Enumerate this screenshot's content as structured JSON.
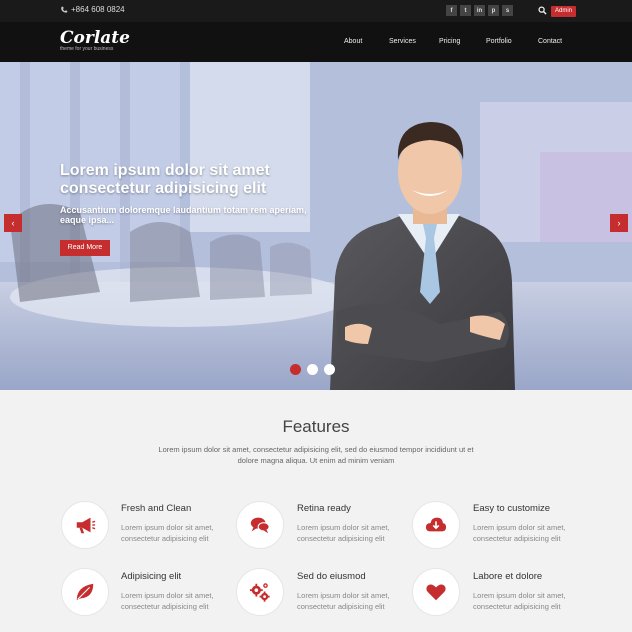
{
  "topbar": {
    "phone": "+864 608 0824",
    "social": [
      {
        "icon": "facebook-icon",
        "glyph": "f"
      },
      {
        "icon": "twitter-icon",
        "glyph": "t"
      },
      {
        "icon": "linkedin-icon",
        "glyph": "in"
      },
      {
        "icon": "pinterest-icon",
        "glyph": "p"
      },
      {
        "icon": "skype-icon",
        "glyph": "s"
      }
    ],
    "admin_label": "Admin"
  },
  "navbar": {
    "logo": "Corlate",
    "tagline": "theme for your business",
    "items": [
      "About",
      "Services",
      "Pricing",
      "Portfolio",
      "Contact"
    ]
  },
  "hero": {
    "title": "Lorem ipsum dolor sit amet consectetur adipisicing elit",
    "subtitle": "Accusantium doloremque laudantium totam rem aperiam, eaque ipsa...",
    "button": "Read More",
    "prev": "‹",
    "next": "›"
  },
  "features": {
    "title": "Features",
    "description": "Lorem ipsum dolor sit amet, consectetur adipisicing elit, sed do eiusmod tempor incididunt ut et dolore magna aliqua. Ut enim ad minim veniam",
    "items": [
      {
        "title": "Fresh and Clean",
        "text": "Lorem ipsum dolor sit amet, consectetur adipisicing elit",
        "icon": "megaphone-icon"
      },
      {
        "title": "Retina ready",
        "text": "Lorem ipsum dolor sit amet, consectetur adipisicing elit",
        "icon": "chat-icon"
      },
      {
        "title": "Easy to customize",
        "text": "Lorem ipsum dolor sit amet, consectetur adipisicing elit",
        "icon": "cloud-download-icon"
      },
      {
        "title": "Adipisicing elit",
        "text": "Lorem ipsum dolor sit amet, consectetur adipisicing elit",
        "icon": "leaf-icon"
      },
      {
        "title": "Sed do eiusmod",
        "text": "Lorem ipsum dolor sit amet, consectetur adipisicing elit",
        "icon": "gears-icon"
      },
      {
        "title": "Labore et dolore",
        "text": "Lorem ipsum dolor sit amet, consectetur adipisicing elit",
        "icon": "heart-icon"
      }
    ]
  },
  "colors": {
    "accent": "#c52d2f",
    "topbar": "#1a1a1a",
    "navbar": "#111111"
  }
}
